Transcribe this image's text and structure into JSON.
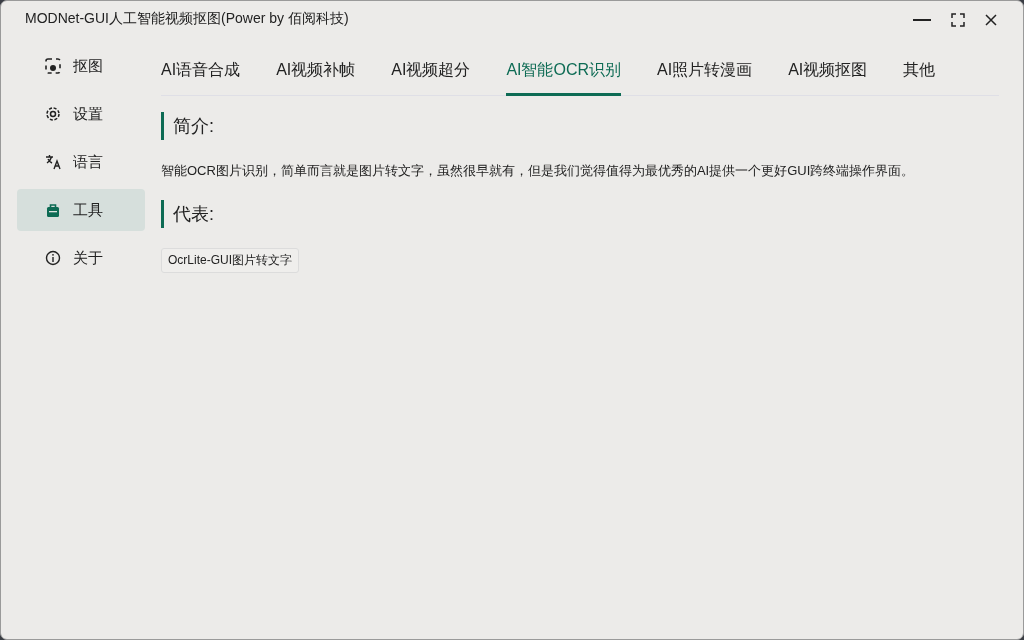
{
  "window": {
    "title": "MODNet-GUI人工智能视频抠图(Power by 佰阅科技)"
  },
  "sidebar": {
    "items": [
      {
        "kind": "matting",
        "label": "抠图",
        "selected": false
      },
      {
        "kind": "settings",
        "label": "设置",
        "selected": false
      },
      {
        "kind": "language",
        "label": "语言",
        "selected": false
      },
      {
        "kind": "tools",
        "label": "工具",
        "selected": true
      },
      {
        "kind": "about",
        "label": "关于",
        "selected": false
      }
    ]
  },
  "tabs": [
    {
      "label": "AI语音合成",
      "selected": false
    },
    {
      "label": "AI视频补帧",
      "selected": false
    },
    {
      "label": "AI视频超分",
      "selected": false
    },
    {
      "label": "AI智能OCR识别",
      "selected": true
    },
    {
      "label": "AI照片转漫画",
      "selected": false
    },
    {
      "label": "AI视频抠图",
      "selected": false
    },
    {
      "label": "其他",
      "selected": false
    }
  ],
  "sections": [
    {
      "heading": "简介:",
      "kind": "text",
      "text": "智能OCR图片识别，简单而言就是图片转文字，虽然很早就有，但是我们觉得值得为最优秀的AI提供一个更好GUI跨终端操作界面。"
    },
    {
      "heading": "代表:",
      "kind": "tags",
      "tags": [
        "OcrLite-GUI图片转文字"
      ]
    }
  ]
}
